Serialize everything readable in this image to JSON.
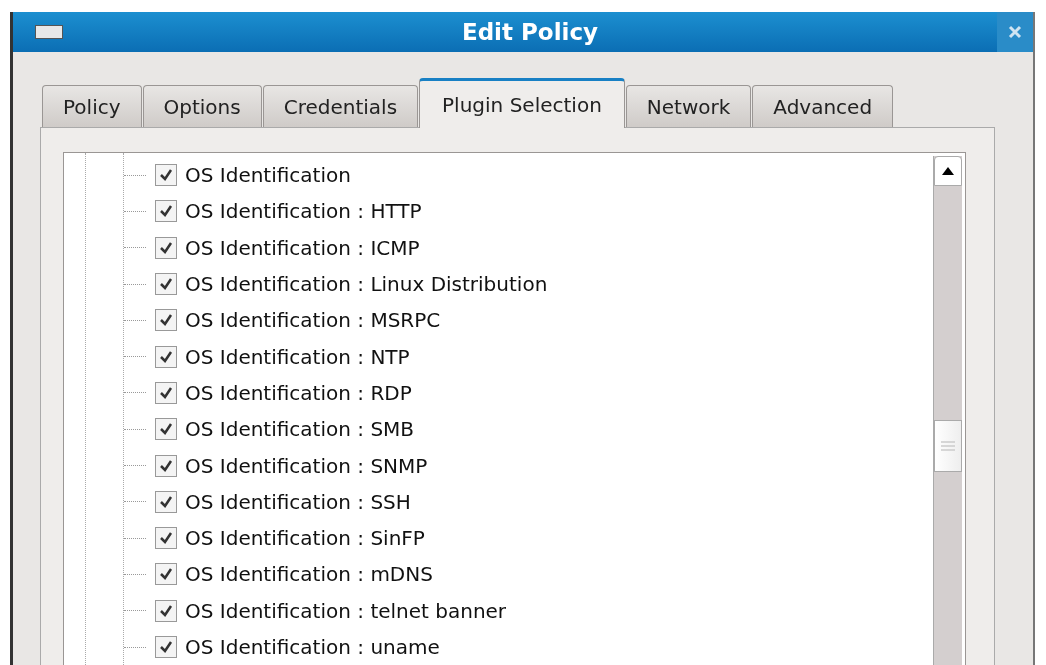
{
  "window": {
    "title": "Edit Policy"
  },
  "tabs": [
    {
      "label": "Policy",
      "selected": false
    },
    {
      "label": "Options",
      "selected": false
    },
    {
      "label": "Credentials",
      "selected": false
    },
    {
      "label": "Plugin Selection",
      "selected": true
    },
    {
      "label": "Network",
      "selected": false
    },
    {
      "label": "Advanced",
      "selected": false
    }
  ],
  "plugins": [
    {
      "label": "OS Identification",
      "checked": true
    },
    {
      "label": "OS Identification : HTTP",
      "checked": true
    },
    {
      "label": "OS Identification : ICMP",
      "checked": true
    },
    {
      "label": "OS Identification : Linux Distribution",
      "checked": true
    },
    {
      "label": "OS Identification : MSRPC",
      "checked": true
    },
    {
      "label": "OS Identification : NTP",
      "checked": true
    },
    {
      "label": "OS Identification : RDP",
      "checked": true
    },
    {
      "label": "OS Identification : SMB",
      "checked": true
    },
    {
      "label": "OS Identification : SNMP",
      "checked": true
    },
    {
      "label": "OS Identification : SSH",
      "checked": true
    },
    {
      "label": "OS Identification : SinFP",
      "checked": true
    },
    {
      "label": "OS Identification : mDNS",
      "checked": true
    },
    {
      "label": "OS Identification : telnet banner",
      "checked": true
    },
    {
      "label": "OS Identification : uname",
      "checked": true
    }
  ]
}
